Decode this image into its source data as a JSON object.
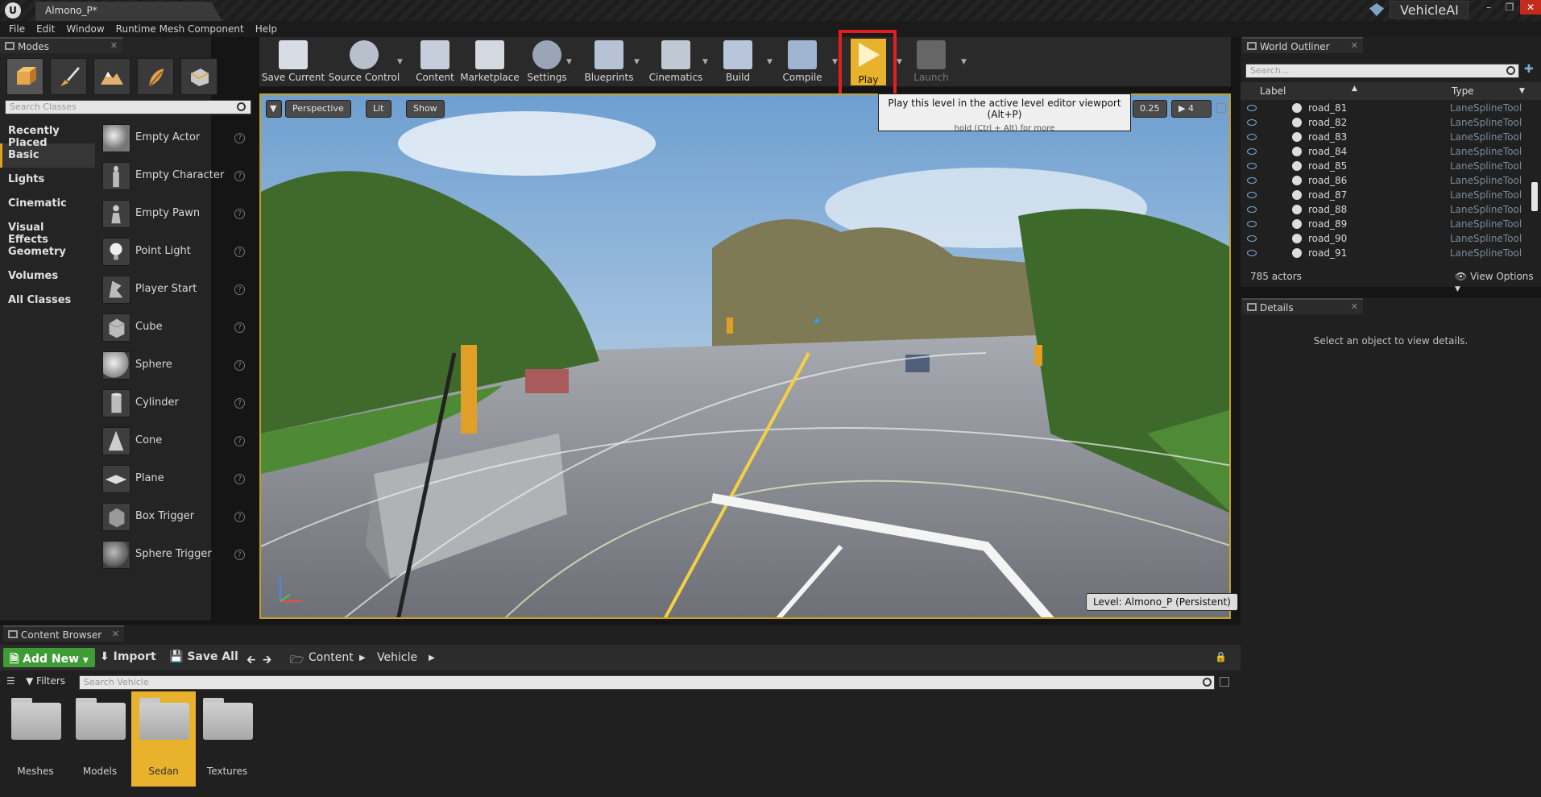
{
  "titlebar": {
    "doc_tab": "Almono_P*",
    "project": "VehicleAI"
  },
  "menu": [
    "File",
    "Edit",
    "Window",
    "Runtime Mesh Component",
    "Help"
  ],
  "modes": {
    "tab": "Modes",
    "search_placeholder": "Search Classes",
    "categories": [
      "Recently Placed",
      "Basic",
      "Lights",
      "Cinematic",
      "Visual Effects",
      "Geometry",
      "Volumes",
      "All Classes"
    ],
    "actors": [
      "Empty Actor",
      "Empty Character",
      "Empty Pawn",
      "Point Light",
      "Player Start",
      "Cube",
      "Sphere",
      "Cylinder",
      "Cone",
      "Plane",
      "Box Trigger",
      "Sphere Trigger"
    ]
  },
  "toolbar": {
    "save_current": "Save Current",
    "source_control": "Source Control",
    "content": "Content",
    "marketplace": "Marketplace",
    "settings": "Settings",
    "blueprints": "Blueprints",
    "cinematics": "Cinematics",
    "build": "Build",
    "compile": "Compile",
    "play": "Play",
    "launch": "Launch"
  },
  "viewport": {
    "perspective": "Perspective",
    "lit": "Lit",
    "show": "Show",
    "snap_value": "0.25",
    "camera_speed": "4",
    "level_label": "Level:  Almono_P (Persistent)"
  },
  "tooltip": {
    "main": "Play this level in the active level editor viewport (Alt+P)",
    "sub": "hold (Ctrl + Alt) for more"
  },
  "outliner": {
    "tab": "World Outliner",
    "search_placeholder": "Search...",
    "col_label": "Label",
    "col_type": "Type",
    "rows": [
      {
        "label": "road_81",
        "type": "LaneSplineTool"
      },
      {
        "label": "road_82",
        "type": "LaneSplineTool"
      },
      {
        "label": "road_83",
        "type": "LaneSplineTool"
      },
      {
        "label": "road_84",
        "type": "LaneSplineTool"
      },
      {
        "label": "road_85",
        "type": "LaneSplineTool"
      },
      {
        "label": "road_86",
        "type": "LaneSplineTool"
      },
      {
        "label": "road_87",
        "type": "LaneSplineTool"
      },
      {
        "label": "road_88",
        "type": "LaneSplineTool"
      },
      {
        "label": "road_89",
        "type": "LaneSplineTool"
      },
      {
        "label": "road_90",
        "type": "LaneSplineTool"
      },
      {
        "label": "road_91",
        "type": "LaneSplineTool"
      }
    ],
    "actor_count": "785 actors",
    "view_options": "View Options"
  },
  "details": {
    "tab": "Details",
    "empty": "Select an object to view details."
  },
  "content_browser": {
    "tab": "Content Browser",
    "add_new": "Add New",
    "import": "Import",
    "save_all": "Save All",
    "path": [
      "Content",
      "Vehicle"
    ],
    "filters": "Filters",
    "search_placeholder": "Search Vehicle",
    "folders": [
      "Meshes",
      "Models",
      "Sedan",
      "Textures"
    ]
  },
  "colors": {
    "accent": "#e8b22d",
    "highlight": "#e31e1e",
    "add_new": "#3f9c35"
  }
}
